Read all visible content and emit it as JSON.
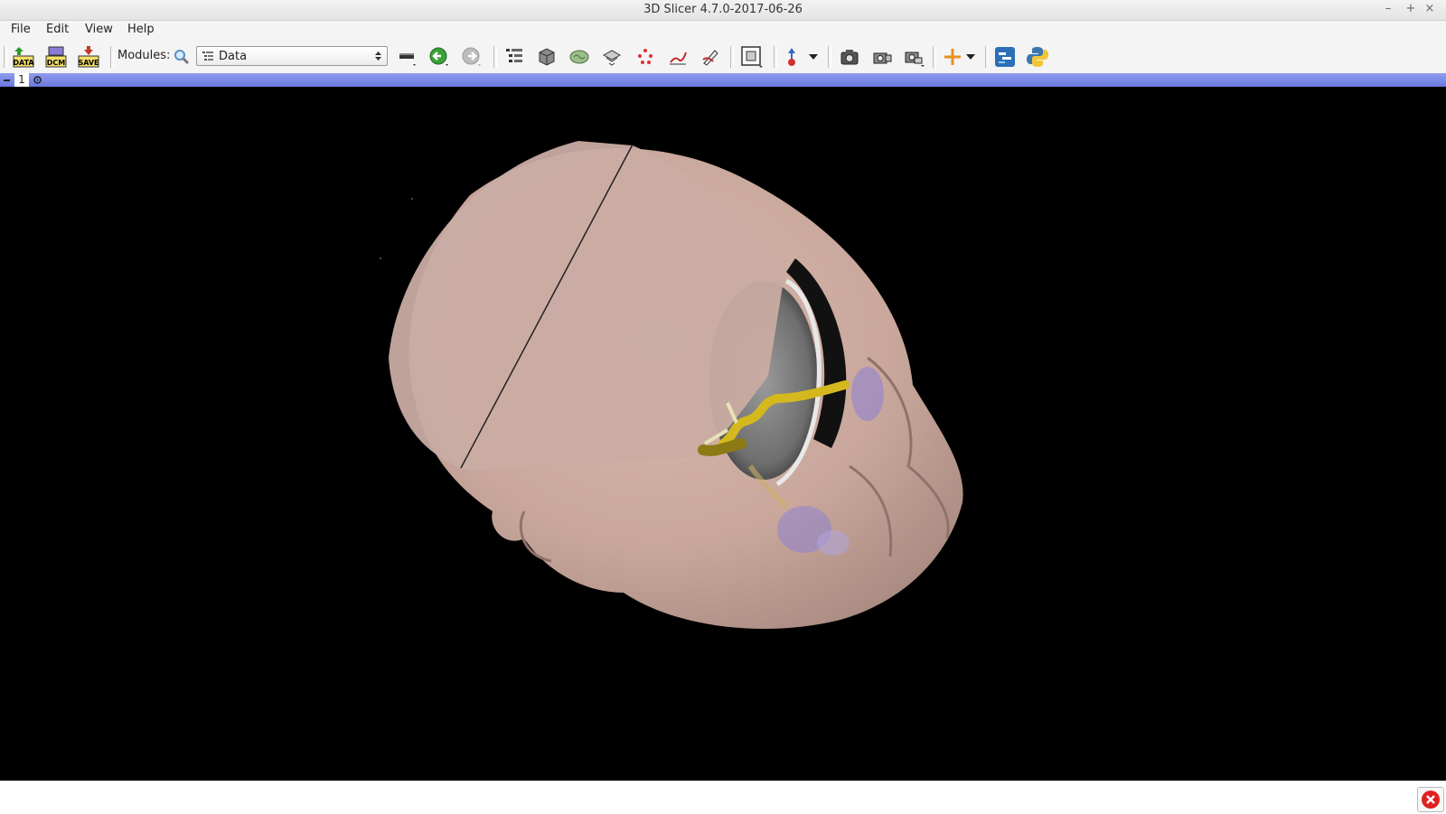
{
  "window": {
    "title": "3D Slicer 4.7.0-2017-06-26",
    "minimize": "–",
    "maximize": "+",
    "close": "×"
  },
  "menubar": {
    "items": [
      "File",
      "Edit",
      "View",
      "Help"
    ]
  },
  "toolbar": {
    "load_data": "DATA",
    "dicom": "DCM",
    "save": "SAVE",
    "modules_label": "Modules:",
    "module_selected": "Data"
  },
  "viewer": {
    "view_label": "1"
  },
  "colors": {
    "skin": "#d8b8ad",
    "vessel": "#d4b81e",
    "bluebar": "#7f8ce8",
    "error": "#e02020"
  }
}
